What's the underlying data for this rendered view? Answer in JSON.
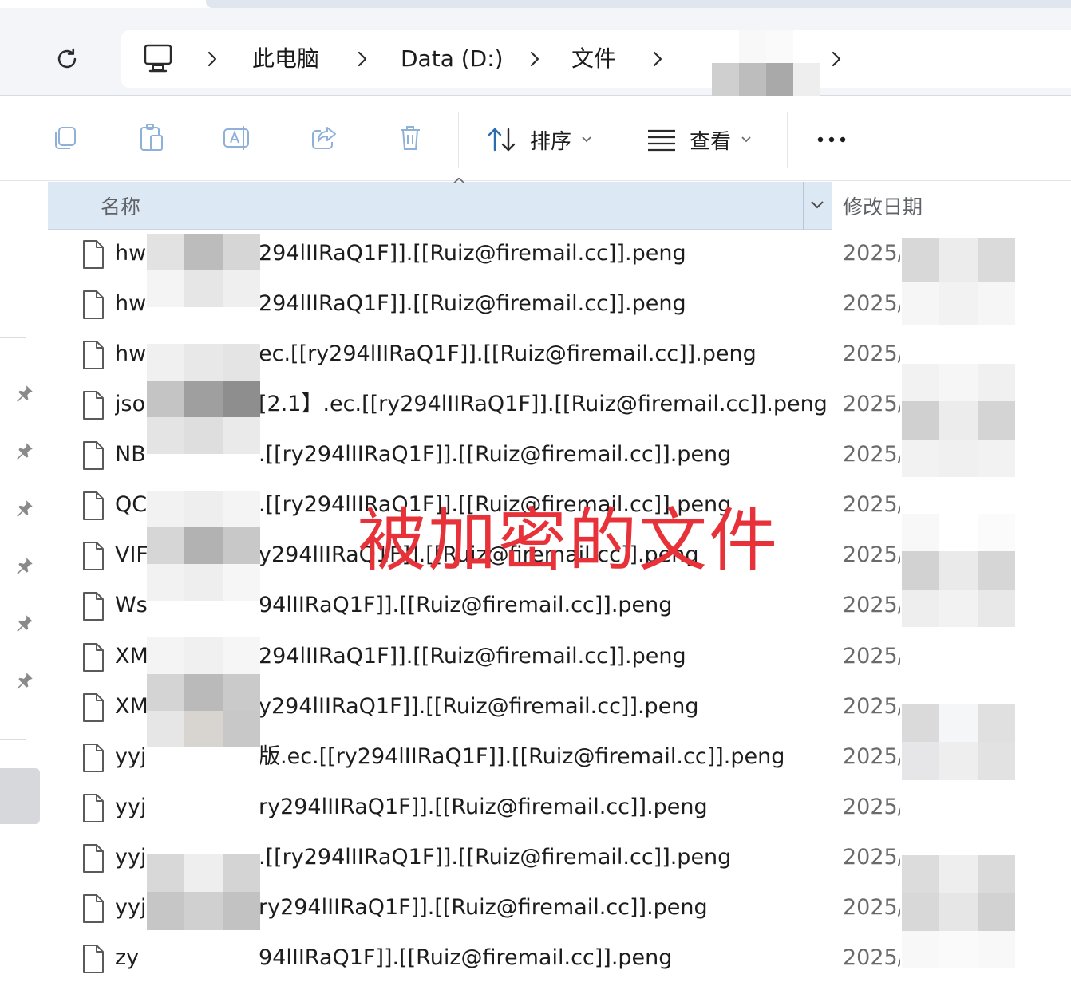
{
  "address_bar": {
    "crumbs": [
      "此电脑",
      "Data (D:)",
      "文件"
    ],
    "separator": ">"
  },
  "toolbar": {
    "sort_label": "排序",
    "view_label": "查看",
    "more_label": "..."
  },
  "columns": {
    "name": "名称",
    "date": "修改日期"
  },
  "files": [
    {
      "start": "hw",
      "rest": "294lIIRaQ1F]].[[Ruiz@firemail.cc]].peng",
      "date": "2025/"
    },
    {
      "start": "hw",
      "rest": "294lIIRaQ1F]].[[Ruiz@firemail.cc]].peng",
      "date": "2025/"
    },
    {
      "start": "hw",
      "rest": "ec.[[ry294lIIRaQ1F]].[[Ruiz@firemail.cc]].peng",
      "date": "2025/"
    },
    {
      "start": "jso",
      "rest": "[2.1】.ec.[[ry294lIIRaQ1F]].[[Ruiz@firemail.cc]].peng",
      "date": "2025/"
    },
    {
      "start": "NB",
      "rest": ".[[ry294lIIRaQ1F]].[[Ruiz@firemail.cc]].peng",
      "date": "2025/"
    },
    {
      "start": "QC",
      "rest": ".[[ry294lIIRaQ1F]].[[Ruiz@firemail.cc]].peng",
      "date": "2025/"
    },
    {
      "start": "VIF",
      "rest": "y294lIIRaQ1F]].[[Ruiz@firemail.cc]].peng",
      "date": "2025/"
    },
    {
      "start": "Ws",
      "rest": "94lIIRaQ1F]].[[Ruiz@firemail.cc]].peng",
      "date": "2025/"
    },
    {
      "start": "XM",
      "rest": "294lIIRaQ1F]].[[Ruiz@firemail.cc]].peng",
      "date": "2025/"
    },
    {
      "start": "XM",
      "rest": "y294lIIRaQ1F]].[[Ruiz@firemail.cc]].peng",
      "date": "2025/"
    },
    {
      "start": "yyj",
      "rest": "版.ec.[[ry294lIIRaQ1F]].[[Ruiz@firemail.cc]].peng",
      "date": "2025/"
    },
    {
      "start": "yyj",
      "rest": "ry294lIIRaQ1F]].[[Ruiz@firemail.cc]].peng",
      "date": "2025/"
    },
    {
      "start": "yyj",
      "rest": ".[[ry294lIIRaQ1F]].[[Ruiz@firemail.cc]].peng",
      "date": "2025/"
    },
    {
      "start": "yyj",
      "rest": "ry294lIIRaQ1F]].[[Ruiz@firemail.cc]].peng",
      "date": "2025/"
    },
    {
      "start": "zy",
      "rest": "94lIIRaQ1F]].[[Ruiz@firemail.cc]].peng",
      "date": "2025/"
    }
  ],
  "annotation": "被加密的文件",
  "colors": {
    "header_bg": "#dde8f5",
    "annotation": "#e8323a",
    "address_bg": "#f3f5f9"
  }
}
